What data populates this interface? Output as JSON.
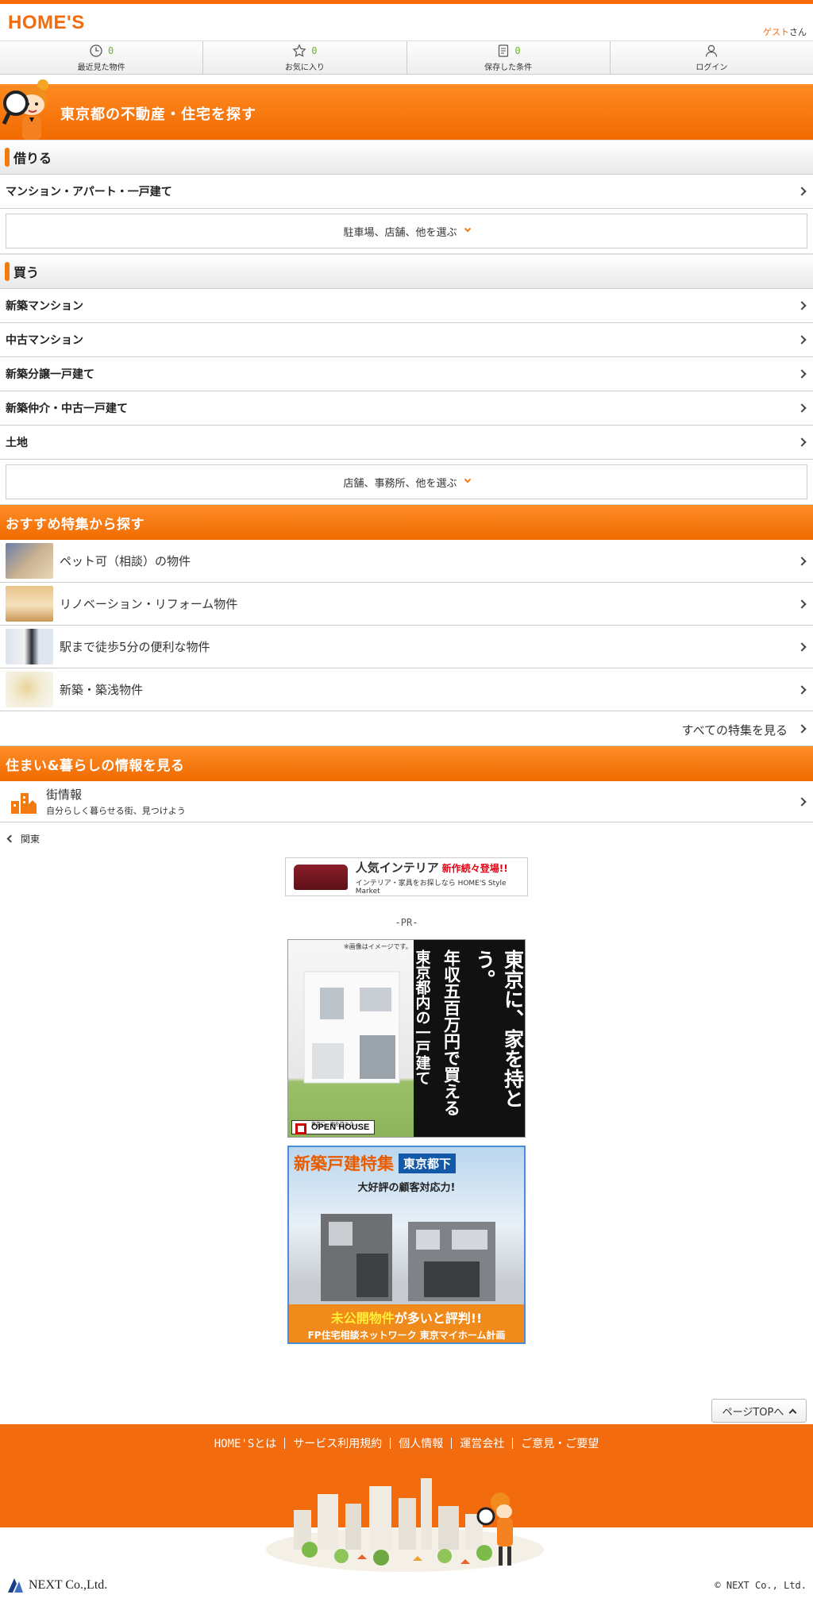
{
  "header": {
    "logo": "HOME'S",
    "guest_name": "ゲスト",
    "guest_suffix": "さん"
  },
  "nav": [
    {
      "icon": "clock-icon",
      "count": "0",
      "label": "最近見た物件"
    },
    {
      "icon": "star-icon",
      "count": "0",
      "label": "お気に入り"
    },
    {
      "icon": "document-icon",
      "count": "0",
      "label": "保存した条件"
    },
    {
      "icon": "user-icon",
      "count": "",
      "label": "ログイン"
    }
  ],
  "hero": {
    "title": "東京都の不動産・住宅を探す"
  },
  "rent": {
    "heading": "借りる",
    "items": [
      "マンション・アパート・一戸建て"
    ],
    "more": "駐車場、店舗、他を選ぶ"
  },
  "buy": {
    "heading": "買う",
    "items": [
      "新築マンション",
      "中古マンション",
      "新築分譲一戸建て",
      "新築仲介・中古一戸建て",
      "土地"
    ],
    "more": "店舗、事務所、他を選ぶ"
  },
  "features": {
    "heading": "おすすめ特集から探す",
    "items": [
      "ペット可（相談）の物件",
      "リノベーション・リフォーム物件",
      "駅まで徒歩5分の便利な物件",
      "新築・築浅物件"
    ],
    "all_link": "すべての特集を見る"
  },
  "info": {
    "heading": "住まい&暮らしの情報を見る",
    "title": "街情報",
    "subtitle": "自分らしく暮らせる街、見つけよう"
  },
  "back": {
    "label": "関東"
  },
  "banner": {
    "title": "人気インテリア",
    "new_label": "新作続々登場!!",
    "sub": "インテリア・家具をお探しなら HOME'S Style Market"
  },
  "pr_label": "-PR-",
  "ad1": {
    "note": "※画像はイメージです。",
    "line1": "東京に、家を持とう。",
    "line2": "年収五百万円で買える",
    "line3": "東京都内の一戸建て",
    "brand_sub": "東京に、家を持とう。",
    "brand": "OPEN HOUSE"
  },
  "ad2": {
    "title": "新築戸建特集",
    "badge": "東京都下",
    "tagline": "大好評の顧客対応力!",
    "bottom_highlight": "未公開物件",
    "bottom_rest": "が多いと評判!!",
    "bottom_sub": "FP住宅相談ネットワーク 東京マイホーム計画"
  },
  "pagetop": {
    "label": "ページTOPへ"
  },
  "footer": {
    "links": [
      "HOME'Sとは",
      "サービス利用規約",
      "個人情報",
      "運営会社",
      "ご意見・ご要望"
    ],
    "company": "NEXT Co.,Ltd.",
    "copyright": "© NEXT Co., Ltd."
  },
  "colors": {
    "accent": "#f26b0f",
    "count_green": "#6ab42d"
  }
}
